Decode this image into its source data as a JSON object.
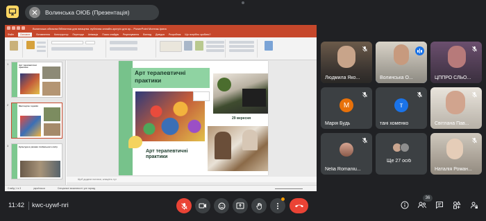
{
  "topbar": {
    "presenter_title": "Волинська ОЮБ (Презентація)"
  },
  "ppt": {
    "window_title": "Волинська обласна бібліотека для юнацтва. публічна онлайн-зустріч для кр...   PowerPoint   Монтаж-Ірина",
    "tabs": [
      "Файл",
      "Основне",
      "Вставлення",
      "Конструктор",
      "Переходи",
      "Анімація",
      "Показ слайдів",
      "Рецензування",
      "Вигляд",
      "Довідка",
      "Розробник",
      "Що потрібно зробити?"
    ],
    "active_tab": "Основне",
    "notes_placeholder": "Щоб додати нотатки, клацніть тут",
    "status_items": [
      "Слайд 1 із 3",
      "українська",
      "Спеціальні можливості: усе гаразд"
    ],
    "thumb_titles": [
      "Арт терапевтичні практики",
      "Мистецтво терапія",
      "Культура в умовах глобального світу"
    ]
  },
  "slide": {
    "title": "Арт терапевтичні практики",
    "caption": "Арт терапевтичні практики",
    "date": "29 вересня"
  },
  "participants": [
    {
      "name": "Людмила Яко...",
      "muted": true
    },
    {
      "name": "Волинська О...",
      "speaking": true
    },
    {
      "name": "ЦППРО СЛЬО...",
      "muted": true
    },
    {
      "name": "Марія Будь",
      "initial": "М",
      "color": "#e8710a",
      "muted": true
    },
    {
      "name": "тані хоменко",
      "initial": "т",
      "color": "#1a73e8",
      "muted": true
    },
    {
      "name": "Світлана Пав...",
      "muted": true
    },
    {
      "name": "Nelia Romaniu...",
      "muted": true
    },
    {
      "name": "Ще 27 осіб"
    },
    {
      "name": "Наталія Роман...",
      "muted": true
    }
  ],
  "bottombar": {
    "time": "11:42",
    "meeting_code": "kwc-uywf-nri",
    "people_count": "36"
  }
}
